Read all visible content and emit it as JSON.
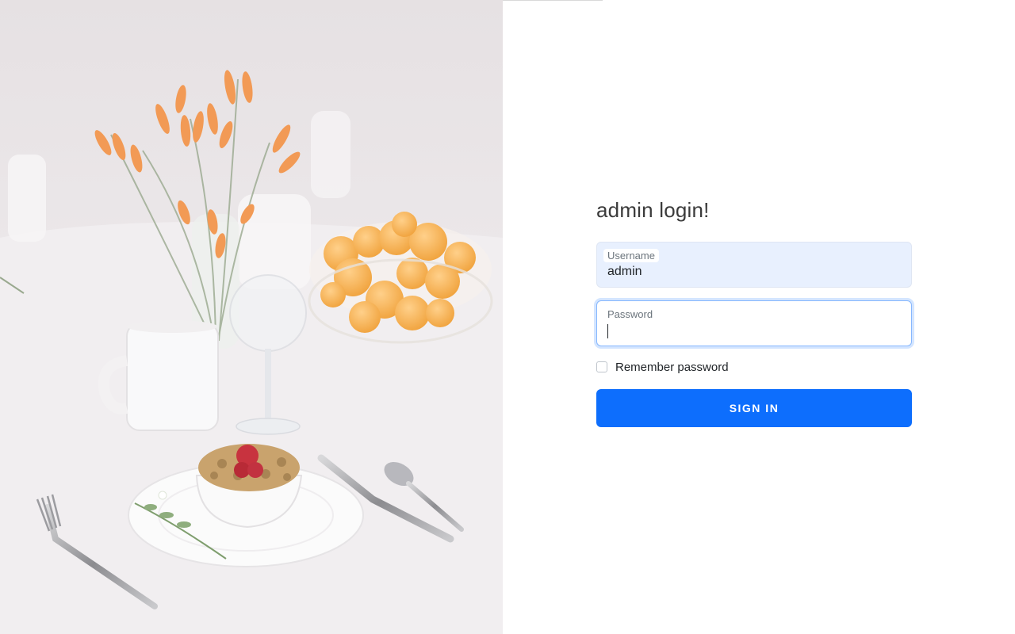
{
  "login": {
    "title": "admin login!",
    "username": {
      "label": "Username",
      "value": "admin"
    },
    "password": {
      "label": "Password",
      "value": ""
    },
    "remember_label": "Remember password",
    "submit_label": "SIGN IN"
  },
  "colors": {
    "primary": "#0d6efd",
    "autofill_bg": "#e8f0fe",
    "focus_ring": "#86b7fe"
  },
  "photo": {
    "icon": "breakfast-table-photo"
  }
}
